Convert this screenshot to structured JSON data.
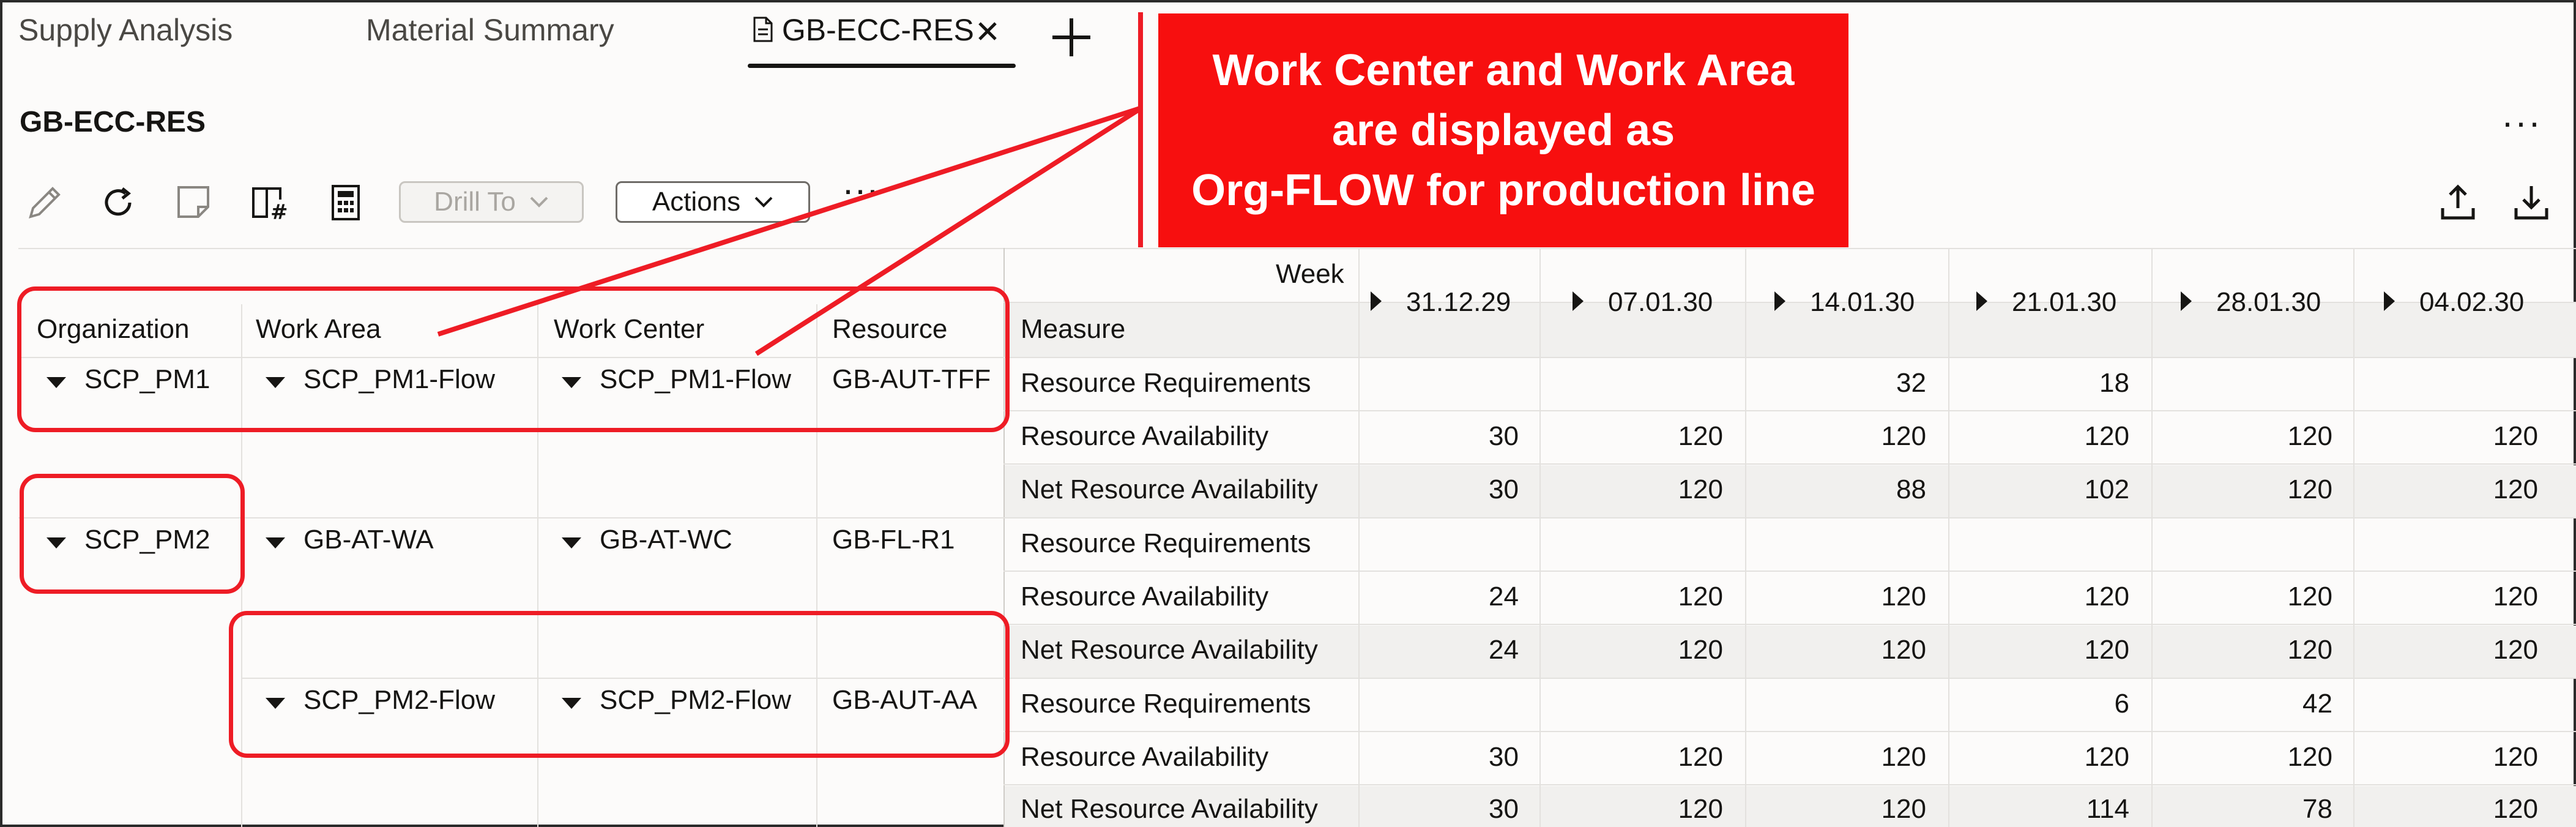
{
  "tabs": [
    {
      "label": "Supply Analysis"
    },
    {
      "label": "Material Summary"
    },
    {
      "label": "GB-ECC-RES"
    }
  ],
  "page_title": "GB-ECC-RES",
  "toolbar": {
    "icons": [
      "edit-icon",
      "refresh-icon",
      "note-icon",
      "table-settings-icon",
      "calculator-icon"
    ],
    "drill_to": "Drill To",
    "actions": "Actions"
  },
  "grid": {
    "row_headers": [
      "Organization",
      "Work Area",
      "Work Center",
      "Resource"
    ],
    "week_label": "Week",
    "measure_label": "Measure",
    "weeks": [
      "31.12.29",
      "07.01.30",
      "14.01.30",
      "21.01.30",
      "28.01.30",
      "04.02.30"
    ],
    "groups": [
      {
        "organization": "SCP_PM1",
        "work_area": "SCP_PM1-Flow",
        "work_center": "SCP_PM1-Flow",
        "resource": "GB-AUT-TFF"
      },
      {
        "organization": "SCP_PM2",
        "work_area": "GB-AT-WA",
        "work_center": "GB-AT-WC",
        "resource": "GB-FL-R1"
      },
      {
        "organization": "",
        "work_area": "SCP_PM2-Flow",
        "work_center": "SCP_PM2-Flow",
        "resource": "GB-AUT-AA"
      }
    ],
    "rows": [
      {
        "measure": "Resource Requirements",
        "values": [
          "",
          "",
          "32",
          "18",
          "",
          ""
        ]
      },
      {
        "measure": "Resource Availability",
        "values": [
          "30",
          "120",
          "120",
          "120",
          "120",
          "120"
        ]
      },
      {
        "measure": "Net Resource Availability",
        "values": [
          "30",
          "120",
          "88",
          "102",
          "120",
          "120"
        ]
      },
      {
        "measure": "Resource Requirements",
        "values": [
          "",
          "",
          "",
          "",
          "",
          ""
        ]
      },
      {
        "measure": "Resource Availability",
        "values": [
          "24",
          "120",
          "120",
          "120",
          "120",
          "120"
        ]
      },
      {
        "measure": "Net Resource Availability",
        "values": [
          "24",
          "120",
          "120",
          "120",
          "120",
          "120"
        ]
      },
      {
        "measure": "Resource Requirements",
        "values": [
          "",
          "",
          "",
          "6",
          "42",
          ""
        ]
      },
      {
        "measure": "Resource Availability",
        "values": [
          "30",
          "120",
          "120",
          "120",
          "120",
          "120"
        ]
      },
      {
        "measure": "Net Resource Availability",
        "values": [
          "30",
          "120",
          "120",
          "114",
          "78",
          "120"
        ]
      }
    ]
  },
  "annotation": {
    "lines": [
      "Work Center and Work Area",
      "are displayed as",
      "Org-FLOW for production line"
    ],
    "color": "#f70f0f"
  }
}
